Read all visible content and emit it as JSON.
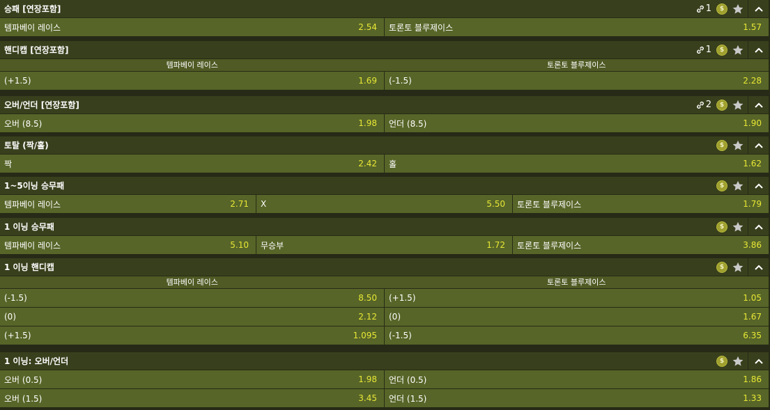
{
  "markets": [
    {
      "title": "승패 [연장포함]",
      "link_count": "1",
      "coin": "$",
      "rows": [
        [
          {
            "label": "템파베이 레이스",
            "odds": "2.54"
          },
          {
            "label": "토론토 블루제이스",
            "odds": "1.57"
          }
        ]
      ]
    },
    {
      "title": "핸디캡 [연장포함]",
      "link_count": "1",
      "coin": "$",
      "columns": [
        "템파베이 레이스",
        "토론토 블루제이스"
      ],
      "rows": [
        [
          {
            "label": "(+1.5)",
            "odds": "1.69"
          },
          {
            "label": "(-1.5)",
            "odds": "2.28"
          }
        ]
      ]
    },
    {
      "title": "오버/언더 [연장포함]",
      "link_count": "2",
      "coin": "$",
      "rows": [
        [
          {
            "label": "오버 (8.5)",
            "odds": "1.98"
          },
          {
            "label": "언더 (8.5)",
            "odds": "1.90"
          }
        ]
      ]
    },
    {
      "title": "토탈 (짝/홀)",
      "coin": "$",
      "rows": [
        [
          {
            "label": "짝",
            "odds": "2.42"
          },
          {
            "label": "홀",
            "odds": "1.62"
          }
        ]
      ]
    },
    {
      "title": "1~5이닝 승무패",
      "coin": "$",
      "rows": [
        [
          {
            "label": "템파베이 레이스",
            "odds": "2.71"
          },
          {
            "label": "X",
            "odds": "5.50"
          },
          {
            "label": "토론토 블루제이스",
            "odds": "1.79"
          }
        ]
      ]
    },
    {
      "title": "1 이닝 승무패",
      "coin": "$",
      "rows": [
        [
          {
            "label": "템파베이 레이스",
            "odds": "5.10"
          },
          {
            "label": "무승부",
            "odds": "1.72"
          },
          {
            "label": "토론토 블루제이스",
            "odds": "3.86"
          }
        ]
      ]
    },
    {
      "title": "1 이닝 핸디캡",
      "coin": "$",
      "columns": [
        "템파베이 레이스",
        "토론토 블루제이스"
      ],
      "rows": [
        [
          {
            "label": "(-1.5)",
            "odds": "8.50"
          },
          {
            "label": "(+1.5)",
            "odds": "1.05"
          }
        ],
        [
          {
            "label": "(0)",
            "odds": "2.12"
          },
          {
            "label": "(0)",
            "odds": "1.67"
          }
        ],
        [
          {
            "label": "(+1.5)",
            "odds": "1.095"
          },
          {
            "label": "(-1.5)",
            "odds": "6.35"
          }
        ]
      ]
    },
    {
      "title": "1 이닝: 오버/언더",
      "coin": "$",
      "rows": [
        [
          {
            "label": "오버 (0.5)",
            "odds": "1.98"
          },
          {
            "label": "언더 (0.5)",
            "odds": "1.86"
          }
        ],
        [
          {
            "label": "오버 (1.5)",
            "odds": "3.45"
          },
          {
            "label": "언더 (1.5)",
            "odds": "1.33"
          }
        ]
      ]
    }
  ]
}
